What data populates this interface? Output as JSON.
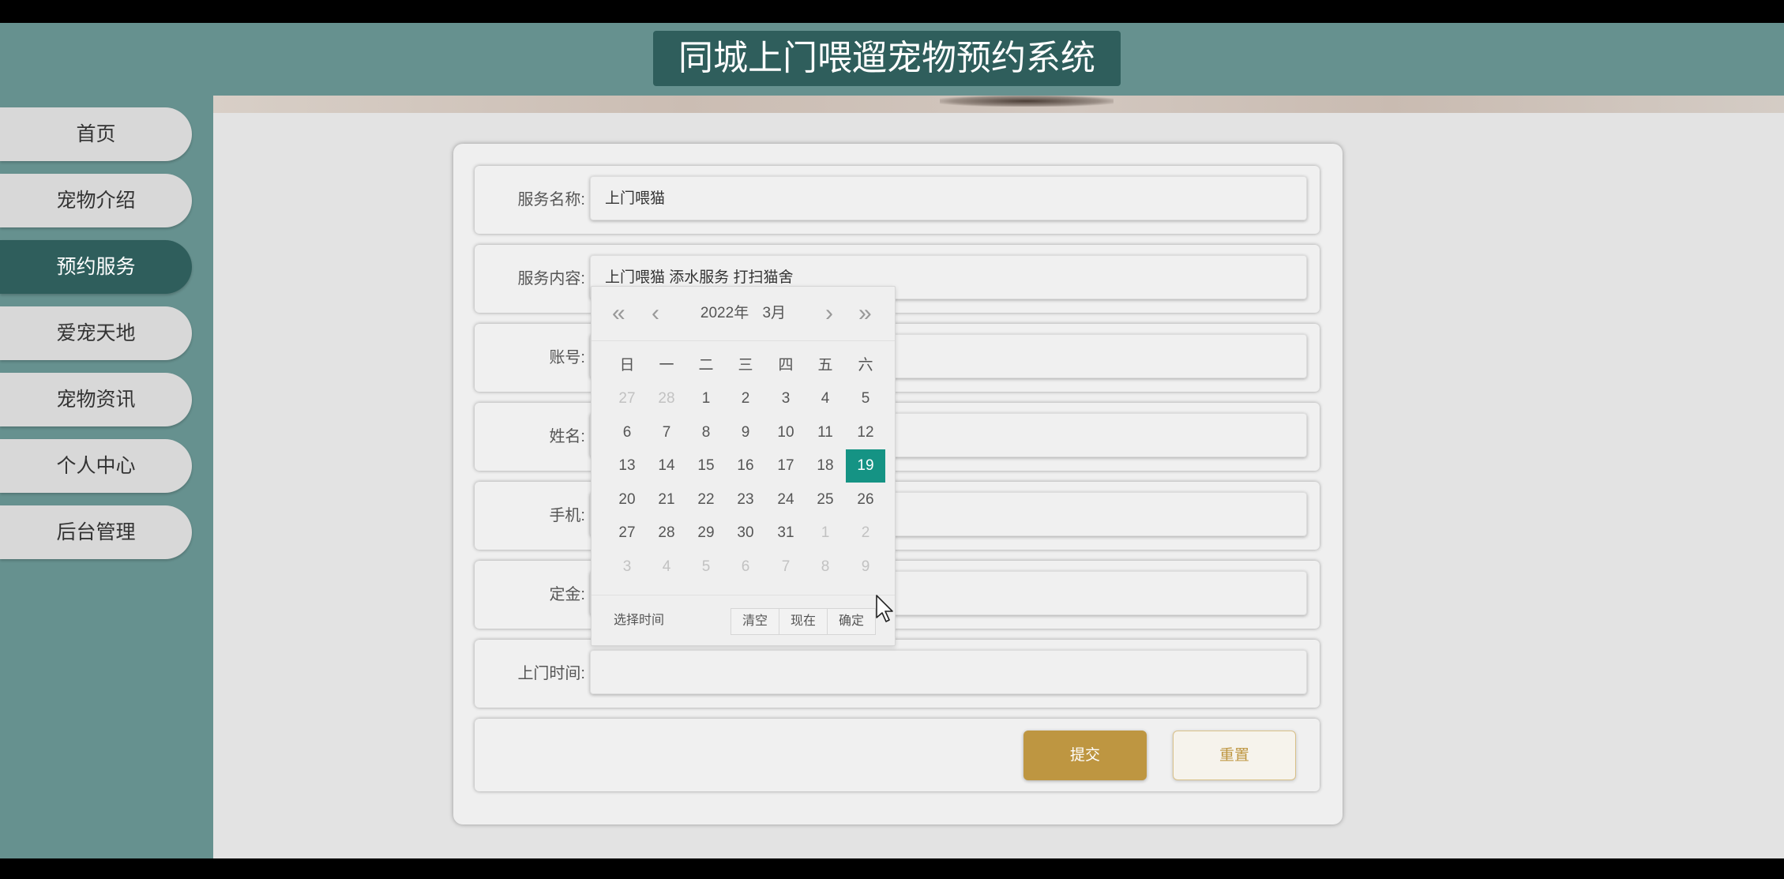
{
  "header": {
    "title": "同城上门喂遛宠物预约系统"
  },
  "sidebar": {
    "items": [
      {
        "label": "首页",
        "active": false
      },
      {
        "label": "宠物介绍",
        "active": false
      },
      {
        "label": "预约服务",
        "active": true
      },
      {
        "label": "爱宠天地",
        "active": false
      },
      {
        "label": "宠物资讯",
        "active": false
      },
      {
        "label": "个人中心",
        "active": false
      },
      {
        "label": "后台管理",
        "active": false
      }
    ]
  },
  "form": {
    "fields": [
      {
        "label": "服务名称:",
        "value": "上门喂猫"
      },
      {
        "label": "服务内容:",
        "value": "上门喂猫 添水服务 打扫猫舍"
      },
      {
        "label": "账号:",
        "value": ""
      },
      {
        "label": "姓名:",
        "value": ""
      },
      {
        "label": "手机:",
        "value": ""
      },
      {
        "label": "定金:",
        "value": ""
      },
      {
        "label": "上门时间:",
        "value": ""
      }
    ],
    "submit_label": "提交",
    "reset_label": "重置"
  },
  "datepicker": {
    "year": "2022年",
    "month": "3月",
    "weekdays": [
      "日",
      "一",
      "二",
      "三",
      "四",
      "五",
      "六"
    ],
    "weeks": [
      [
        "27",
        "28",
        "1",
        "2",
        "3",
        "4",
        "5"
      ],
      [
        "6",
        "7",
        "8",
        "9",
        "10",
        "11",
        "12"
      ],
      [
        "13",
        "14",
        "15",
        "16",
        "17",
        "18",
        "19"
      ],
      [
        "20",
        "21",
        "22",
        "23",
        "24",
        "25",
        "26"
      ],
      [
        "27",
        "28",
        "29",
        "30",
        "31",
        "1",
        "2"
      ],
      [
        "3",
        "4",
        "5",
        "6",
        "7",
        "8",
        "9"
      ]
    ],
    "selected_day": "19",
    "footer_label": "选择时间",
    "buttons": [
      "清空",
      "现在",
      "确定"
    ]
  },
  "colors": {
    "accent": "#66918f",
    "accent_dark": "#2f5e5c",
    "button_gold": "#be9641",
    "selected_day": "#159384"
  }
}
